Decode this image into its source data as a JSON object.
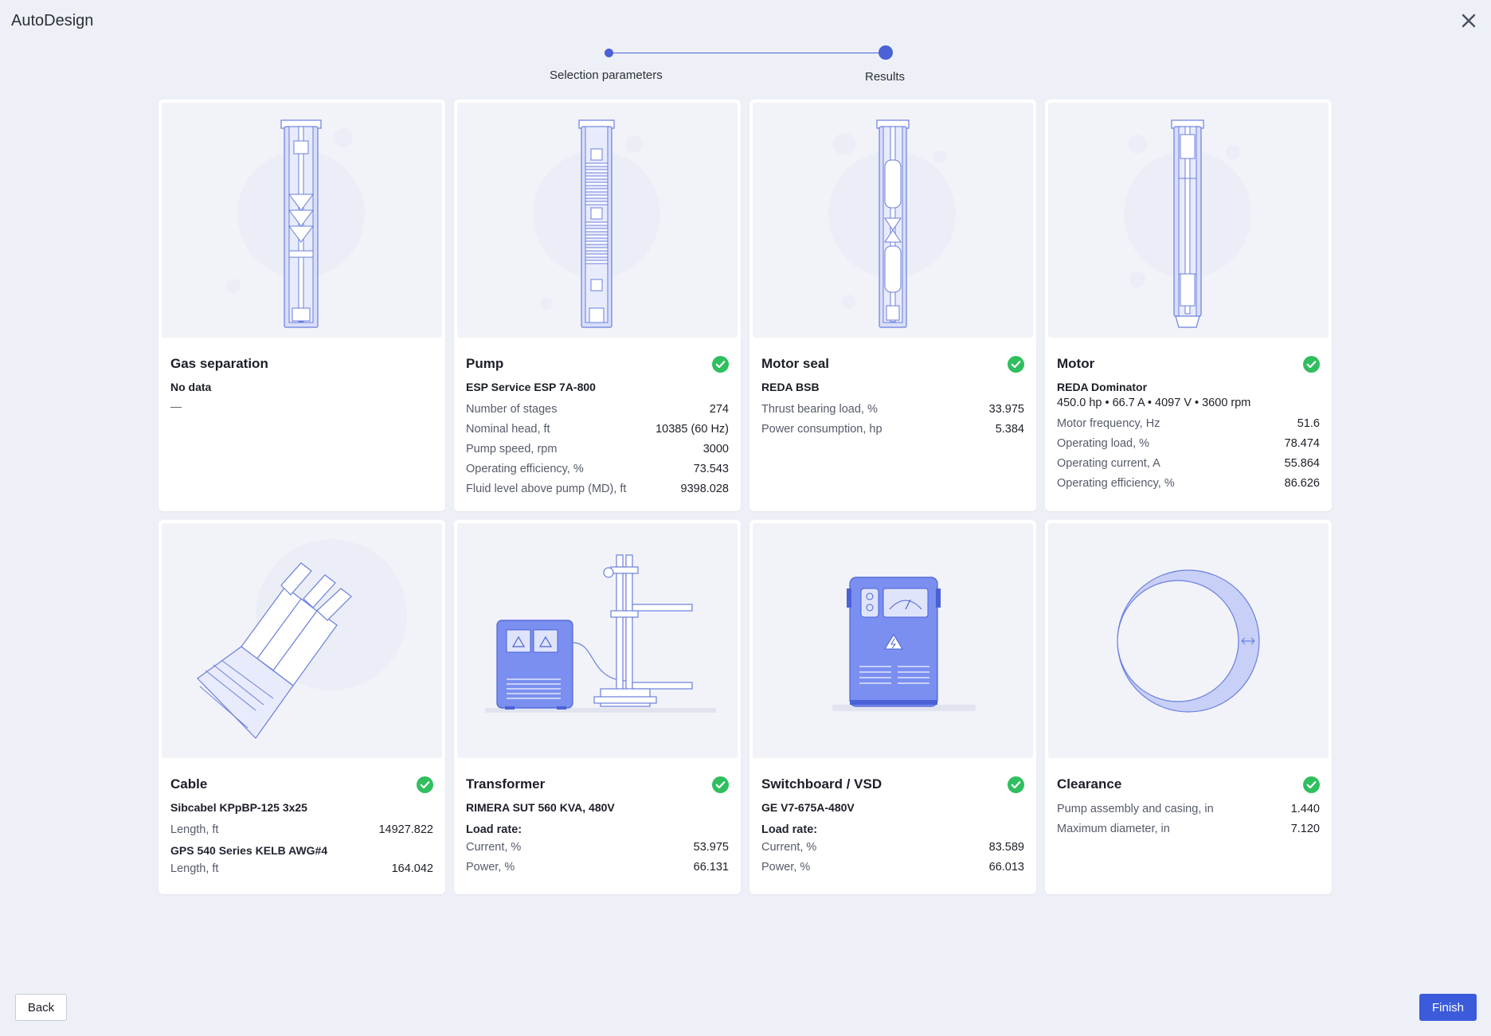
{
  "app": {
    "title": "AutoDesign"
  },
  "stepper": {
    "step1": "Selection parameters",
    "step2": "Results"
  },
  "colors": {
    "accent": "#3b5bdb",
    "success": "#2fbf5f",
    "illustration": "#5a74e0"
  },
  "cards": [
    {
      "title": "Gas separation",
      "status_ok": false,
      "subtitle": "No data",
      "empty": "—"
    },
    {
      "title": "Pump",
      "status_ok": true,
      "subtitle": "ESP Service ESP 7A-800",
      "rows": [
        {
          "label": "Number of stages",
          "value": "274"
        },
        {
          "label": "Nominal head, ft",
          "value": "10385 (60 Hz)"
        },
        {
          "label": "Pump speed, rpm",
          "value": "3000"
        },
        {
          "label": "Operating efficiency, %",
          "value": "73.543"
        },
        {
          "label": "Fluid level above pump (MD), ft",
          "value": "9398.028"
        }
      ]
    },
    {
      "title": "Motor seal",
      "status_ok": true,
      "subtitle": "REDA BSB",
      "rows": [
        {
          "label": "Thrust bearing load, %",
          "value": "33.975"
        },
        {
          "label": "Power consumption, hp",
          "value": "5.384"
        }
      ]
    },
    {
      "title": "Motor",
      "status_ok": true,
      "subtitle": "REDA Dominator",
      "specs": "450.0 hp • 66.7 A • 4097 V • 3600 rpm",
      "rows": [
        {
          "label": "Motor frequency, Hz",
          "value": "51.6"
        },
        {
          "label": "Operating load, %",
          "value": "78.474"
        },
        {
          "label": "Operating current, A",
          "value": "55.864"
        },
        {
          "label": "Operating efficiency, %",
          "value": "86.626"
        }
      ]
    },
    {
      "title": "Cable",
      "status_ok": true,
      "subtitle": "Sibcabel KPpBP-125 3x25",
      "rows": [
        {
          "label": "Length, ft",
          "value": "14927.822"
        }
      ],
      "subtitle2": "GPS 540 Series KELB AWG#4",
      "rows2": [
        {
          "label": "Length, ft",
          "value": "164.042"
        }
      ]
    },
    {
      "title": "Transformer",
      "status_ok": true,
      "subtitle": "RIMERA SUT 560 KVA, 480V",
      "load_label": "Load rate:",
      "rows": [
        {
          "label": "Current, %",
          "value": "53.975"
        },
        {
          "label": "Power, %",
          "value": "66.131"
        }
      ]
    },
    {
      "title": "Switchboard / VSD",
      "status_ok": true,
      "subtitle": "GE V7-675A-480V",
      "load_label": "Load rate:",
      "rows": [
        {
          "label": "Current, %",
          "value": "83.589"
        },
        {
          "label": "Power, %",
          "value": "66.013"
        }
      ]
    },
    {
      "title": "Clearance",
      "status_ok": true,
      "rows": [
        {
          "label": "Pump assembly and casing, in",
          "value": "1.440"
        },
        {
          "label": "Maximum diameter, in",
          "value": "7.120"
        }
      ]
    }
  ],
  "footer": {
    "back_label": "Back",
    "finish_label": "Finish"
  }
}
